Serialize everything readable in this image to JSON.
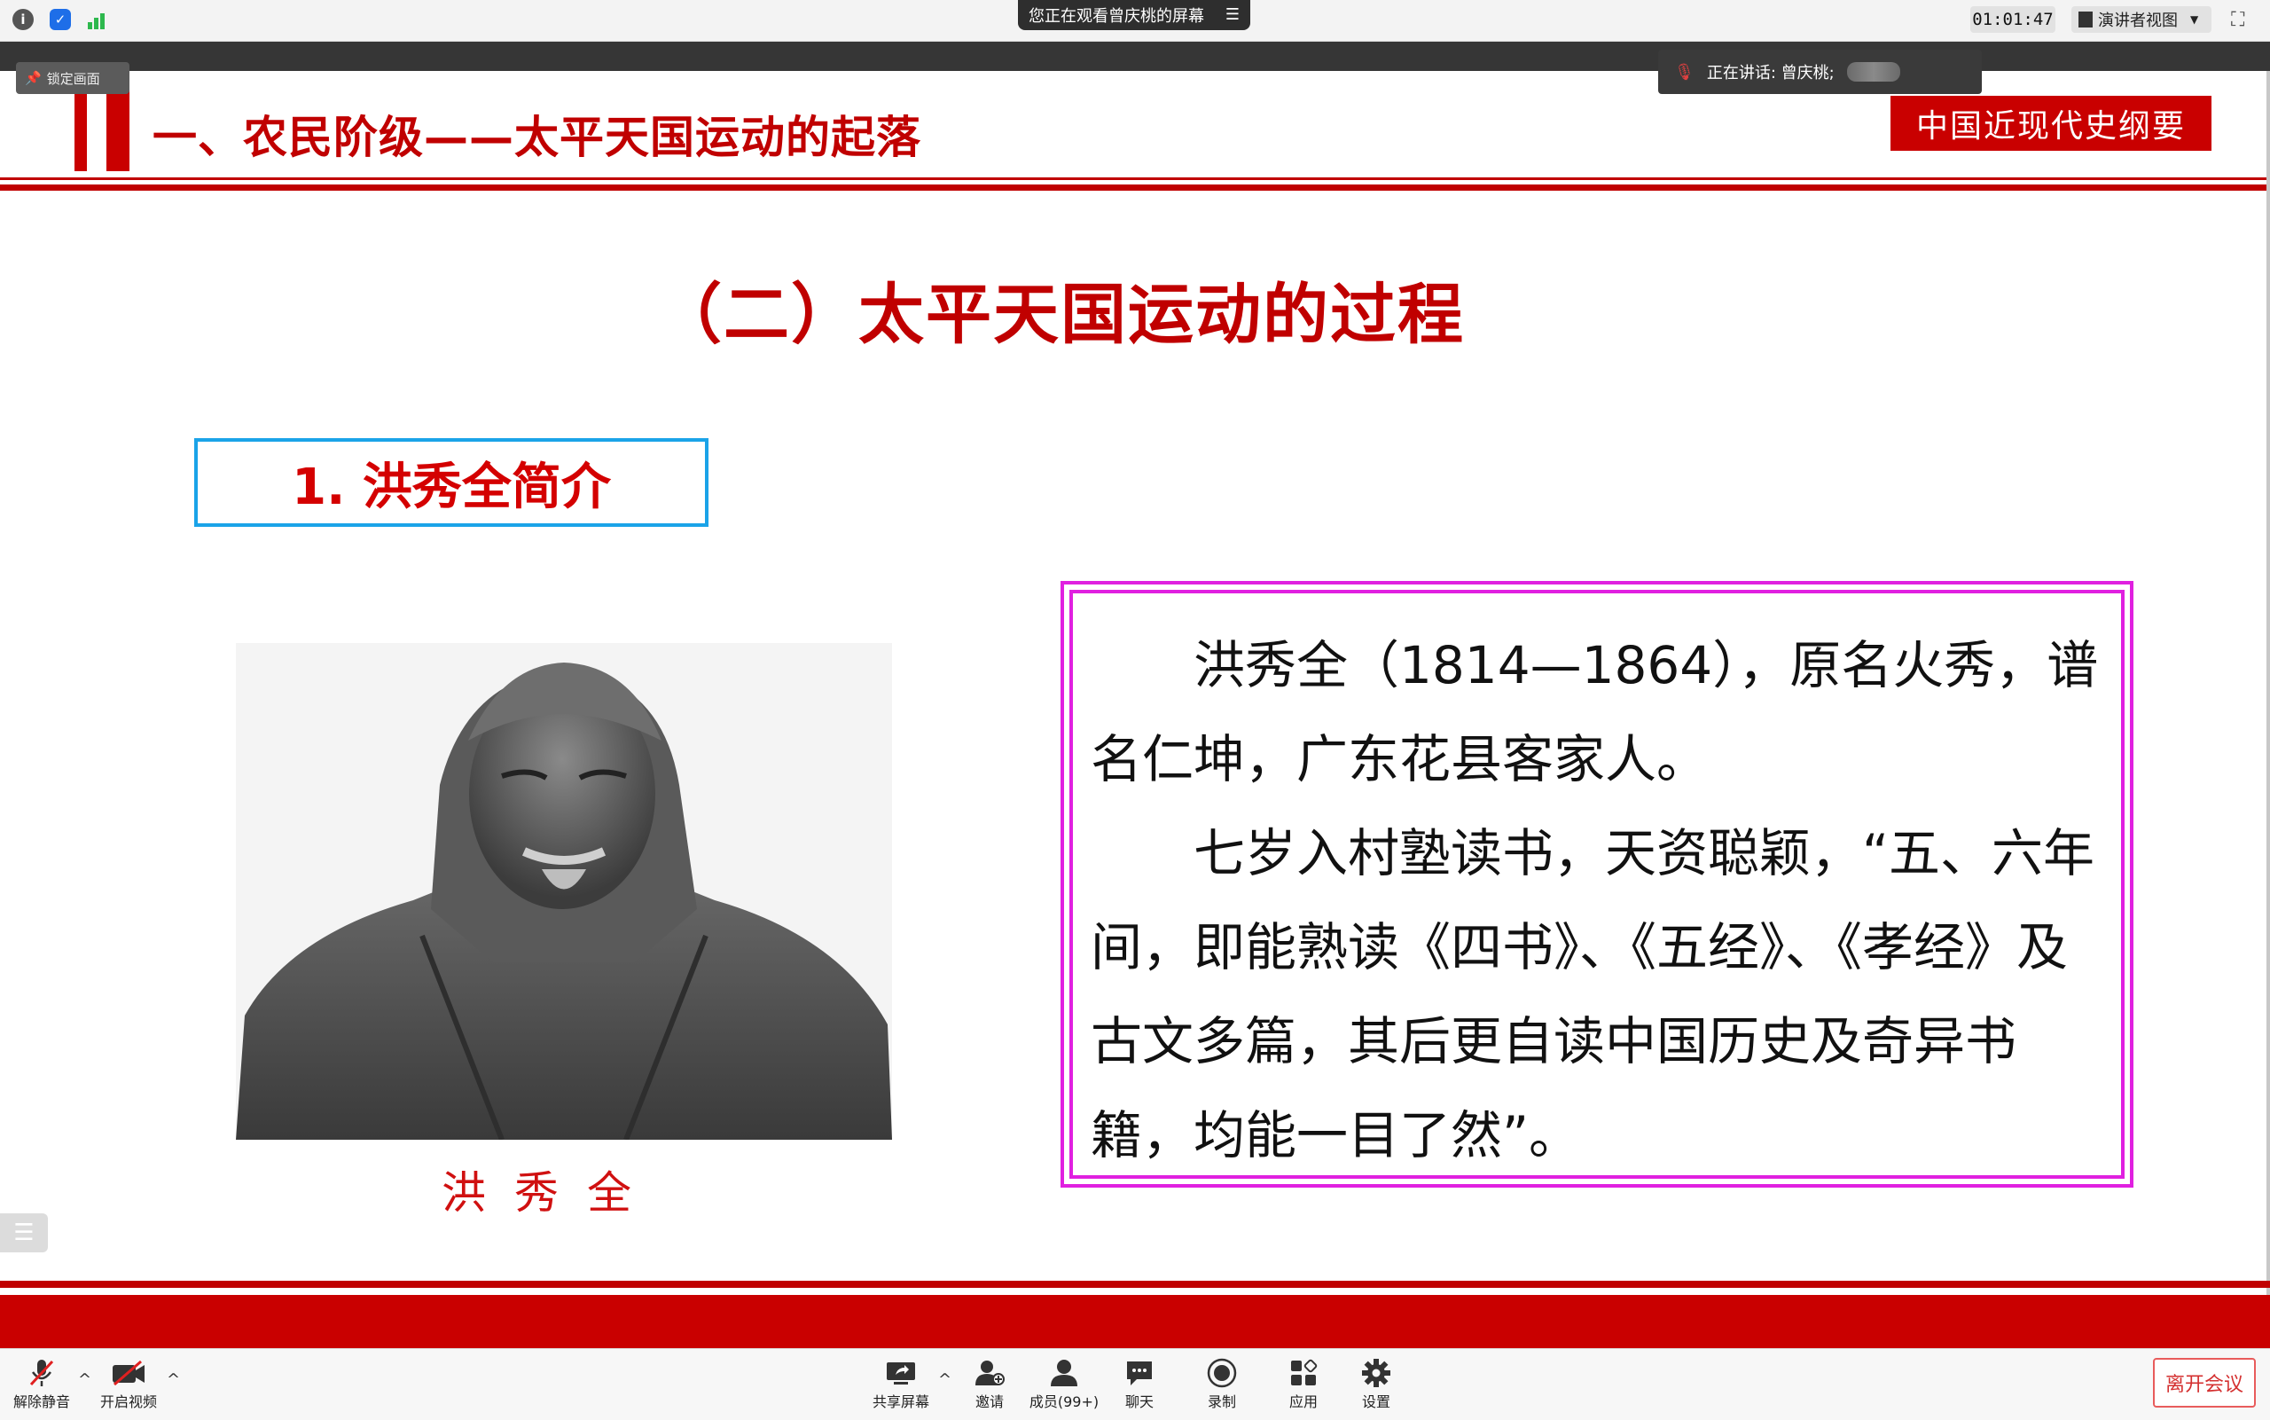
{
  "topbar": {
    "viewing_text": "您正在观看曾庆桃的屏幕",
    "timer": "01:01:47",
    "view_mode": "演讲者视图",
    "lock_screen": "锁定画面",
    "speaking": "正在讲话: 曾庆桃;"
  },
  "slide": {
    "section_title": "一、农民阶级——太平天国运动的起落",
    "course_tag": "中国近现代史纲要",
    "subtitle": "（二）太平天国运动的过程",
    "intro_heading": "1. 洪秀全简介",
    "portrait_caption": "洪秀全",
    "paragraph1": "洪秀全（1814—1864），原名火秀，谱名仁坤，广东花县客家人。",
    "paragraph2": "七岁入村塾读书，天资聪颖，“五、六年间，即能熟读《四书》、《五经》、《孝经》及古文多篇，其后更自读中国历史及奇异书籍，均能一目了然”。"
  },
  "toolbar": {
    "unmute": "解除静音",
    "start_video": "开启视频",
    "share_screen": "共享屏幕",
    "invite": "邀请",
    "members": "成员(99+)",
    "chat": "聊天",
    "record": "录制",
    "apps": "应用",
    "settings": "设置",
    "leave": "离开会议"
  },
  "colors": {
    "slide_red": "#c90000",
    "frame_magenta": "#e020e0",
    "box_blue": "#1aa3e8"
  }
}
